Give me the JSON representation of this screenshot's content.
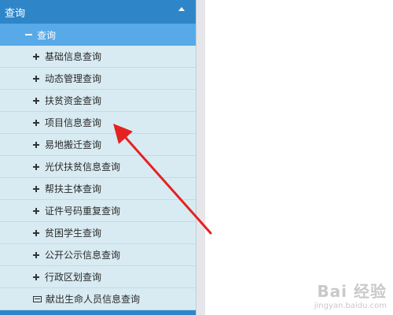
{
  "menu": {
    "title": "查询",
    "group_label": "查询",
    "items": [
      {
        "label": "基础信息查询",
        "icon": "plus-icon"
      },
      {
        "label": "动态管理查询",
        "icon": "plus-icon"
      },
      {
        "label": "扶贫资金查询",
        "icon": "plus-icon"
      },
      {
        "label": "项目信息查询",
        "icon": "plus-icon"
      },
      {
        "label": "易地搬迁查询",
        "icon": "plus-icon"
      },
      {
        "label": "光伏扶贫信息查询",
        "icon": "plus-icon"
      },
      {
        "label": "帮扶主体查询",
        "icon": "plus-icon"
      },
      {
        "label": "证件号码重复查询",
        "icon": "plus-icon"
      },
      {
        "label": "贫困学生查询",
        "icon": "plus-icon"
      },
      {
        "label": "公开公示信息查询",
        "icon": "plus-icon"
      },
      {
        "label": "行政区划查询",
        "icon": "plus-icon"
      },
      {
        "label": "献出生命人员信息查询",
        "icon": "card-icon"
      }
    ]
  },
  "annotation": {
    "color": "#e52222"
  },
  "watermark": {
    "logo": "Bai 经验",
    "url": "jingyan.baidu.com"
  },
  "colors": {
    "header": "#2e86c9",
    "sub_header": "#57a9e8",
    "menu_bg": "#d8ebf2"
  }
}
